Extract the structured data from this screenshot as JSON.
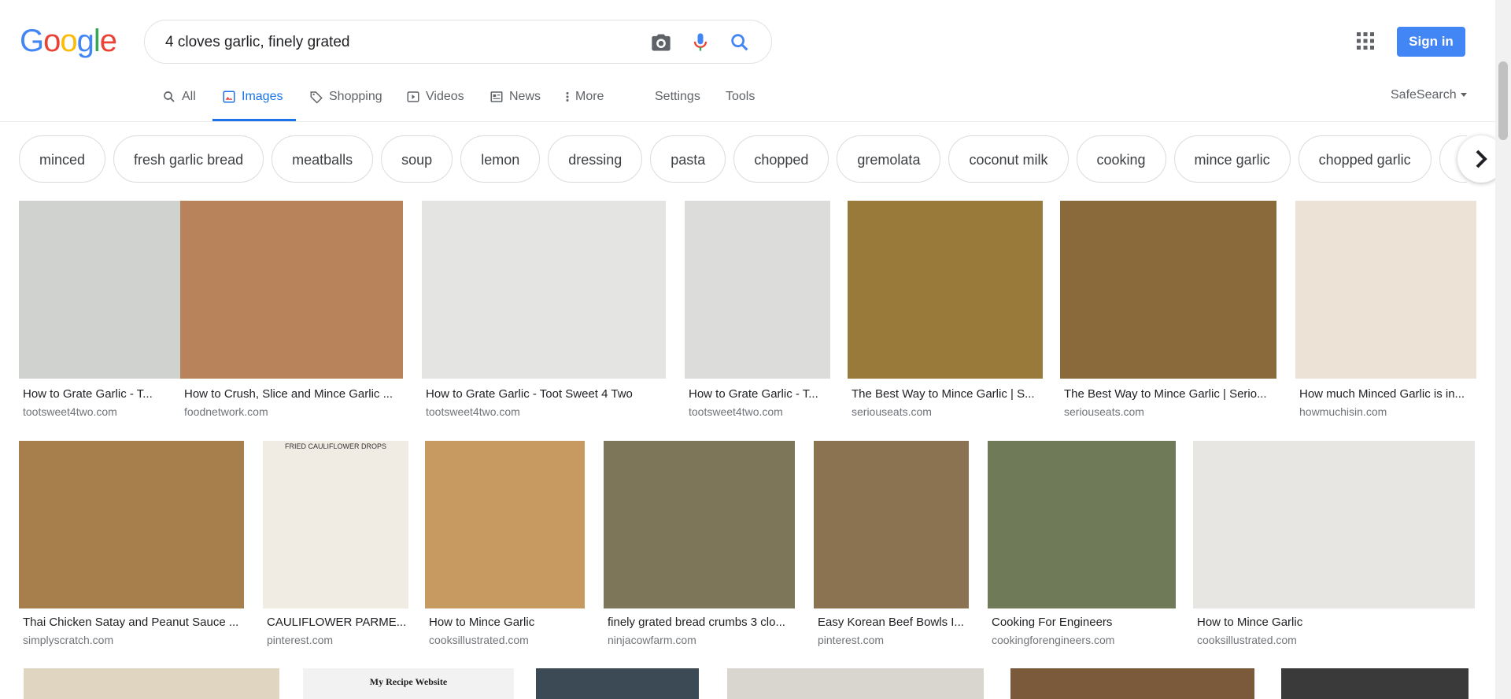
{
  "logo": [
    "G",
    "o",
    "o",
    "g",
    "l",
    "e"
  ],
  "logo_colors": [
    "#4285f4",
    "#ea4335",
    "#fbbc05",
    "#4285f4",
    "#34a853",
    "#ea4335"
  ],
  "search": {
    "value": "4 cloves garlic, finely grated"
  },
  "header": {
    "signin_label": "Sign in",
    "safesearch_label": "SafeSearch",
    "settings_label": "Settings",
    "tools_label": "Tools"
  },
  "tabs": [
    {
      "label": "All",
      "icon": "search-icon"
    },
    {
      "label": "Images",
      "icon": "image-icon"
    },
    {
      "label": "Shopping",
      "icon": "tag-icon"
    },
    {
      "label": "Videos",
      "icon": "play-icon"
    },
    {
      "label": "News",
      "icon": "newspaper-icon"
    },
    {
      "label": "More",
      "icon": "more-vert-icon"
    }
  ],
  "active_tab": "Images",
  "chips": [
    "minced",
    "fresh garlic bread",
    "meatballs",
    "soup",
    "lemon",
    "dressing",
    "pasta",
    "chopped",
    "gremolata",
    "coconut milk",
    "cooking",
    "mince garlic",
    "chopped garlic",
    "p"
  ],
  "results_row1": [
    {
      "title": "How to Grate Garlic - T...",
      "source": "tootsweet4two.com",
      "color": "#cfd2cf"
    },
    {
      "title": "How to Crush, Slice and Mince Garlic ...",
      "source": "foodnetwork.com",
      "color": "#b8825a"
    },
    {
      "title": "How to Grate Garlic - Toot Sweet 4 Two",
      "source": "tootsweet4two.com",
      "color": "#e4e5e3"
    },
    {
      "title": "How to Grate Garlic - T...",
      "source": "tootsweet4two.com",
      "color": "#dcdcda"
    },
    {
      "title": "The Best Way to Mince Garlic | S...",
      "source": "seriouseats.com",
      "color": "#9a7a3a"
    },
    {
      "title": "The Best Way to Mince Garlic | Serio...",
      "source": "seriouseats.com",
      "color": "#8a6a3a"
    },
    {
      "title": "How much Minced Garlic is in...",
      "source": "howmuchisin.com",
      "color": "#ece2d6"
    }
  ],
  "results_row2": [
    {
      "title": "Thai Chicken Satay and Peanut Sauce ...",
      "source": "simplyscratch.com",
      "color": "#a77f4d"
    },
    {
      "title": "CAULIFLOWER PARME...",
      "source": "pinterest.com",
      "color": "#f0ebe3"
    },
    {
      "title": "How to Mince Garlic",
      "source": "cooksillustrated.com",
      "color": "#c79a62"
    },
    {
      "title": "finely grated bread crumbs 3 clo...",
      "source": "ninjacowfarm.com",
      "color": "#7d7658"
    },
    {
      "title": "Easy Korean Beef Bowls I...",
      "source": "pinterest.com",
      "color": "#8b7352"
    },
    {
      "title": "Cooking For Engineers",
      "source": "cookingforengineers.com",
      "color": "#6f7b58"
    },
    {
      "title": "How to Mince Garlic",
      "source": "cooksillustrated.com",
      "color": "#e8e6e3"
    }
  ],
  "row3_colors": [
    "#e0d5c0",
    "#f2f2f2",
    "#3b4a55",
    "#d9d6cf",
    "#7a5a3a",
    "#3a3a3a"
  ],
  "row2_card3_caption": "FRIED CAULIFLOWER DROPS",
  "row3_card2_caption": "My Recipe Website"
}
